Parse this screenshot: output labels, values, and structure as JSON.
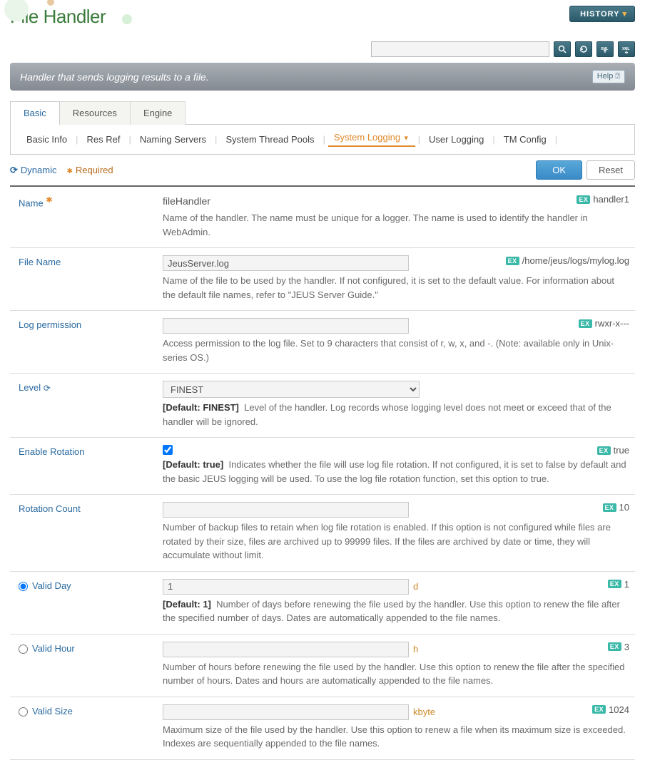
{
  "header": {
    "title": "File Handler",
    "history": "HISTORY",
    "search_placeholder": ""
  },
  "banner": {
    "text": "Handler that sends logging results to a file.",
    "help": "Help"
  },
  "tabs": [
    "Basic",
    "Resources",
    "Engine"
  ],
  "subtabs": [
    "Basic Info",
    "Res Ref",
    "Naming Servers",
    "System Thread Pools",
    "System Logging",
    "User Logging",
    "TM Config"
  ],
  "legend": {
    "dynamic": "Dynamic",
    "required": "Required"
  },
  "actions": {
    "ok": "OK",
    "reset": "Reset"
  },
  "ex_label": "EX",
  "rows": {
    "name": {
      "label": "Name",
      "value": "fileHandler",
      "example": "handler1",
      "desc": "Name of the handler. The name must be unique for a logger. The name is used to identify the handler in WebAdmin."
    },
    "filename": {
      "label": "File Name",
      "value": "JeusServer.log",
      "example": "/home/jeus/logs/mylog.log",
      "desc": "Name of the file to be used by the handler. If not configured, it is set to the default value. For information about the default file names, refer to \"JEUS Server Guide.\""
    },
    "logperm": {
      "label": "Log permission",
      "value": "",
      "example": "rwxr-x---",
      "desc": "Access permission to the log file. Set to 9 characters that consist of r, w, x, and -. (Note: available only in Unix-series OS.)"
    },
    "level": {
      "label": "Level",
      "value": "FINEST",
      "default": "[Default: FINEST]",
      "desc": "Level of the handler. Log records whose logging level does not meet or exceed that of the handler will be ignored."
    },
    "rotation": {
      "label": "Enable Rotation",
      "checked": true,
      "example": "true",
      "default": "[Default: true]",
      "desc": "Indicates whether the file will use log file rotation. If not configured, it is set to false by default and the basic JEUS logging will be used. To use the log file rotation function, set this option to true."
    },
    "rotcount": {
      "label": "Rotation Count",
      "value": "",
      "example": "10",
      "desc": "Number of backup files to retain when log file rotation is enabled. If this option is not configured while files are rotated by their size, files are archived up to 99999 files. If the files are archived by date or time, they will accumulate without limit."
    },
    "validday": {
      "label": "Valid Day",
      "value": "1",
      "unit": "d",
      "example": "1",
      "default": "[Default: 1]",
      "desc": "Number of days before renewing the file used by the handler. Use this option to renew the file after the specified number of days. Dates are automatically appended to the file names."
    },
    "validhour": {
      "label": "Valid Hour",
      "value": "",
      "unit": "h",
      "example": "3",
      "desc": "Number of hours before renewing the file used by the handler. Use this option to renew the file after the specified number of hours. Dates and hours are automatically appended to the file names."
    },
    "validsize": {
      "label": "Valid Size",
      "value": "",
      "unit": "kbyte",
      "example": "1024",
      "desc": "Maximum size of the file used by the handler. Use this option to renew a file when its maximum size is exceeded. Indexes are sequentially appended to the file names."
    }
  }
}
